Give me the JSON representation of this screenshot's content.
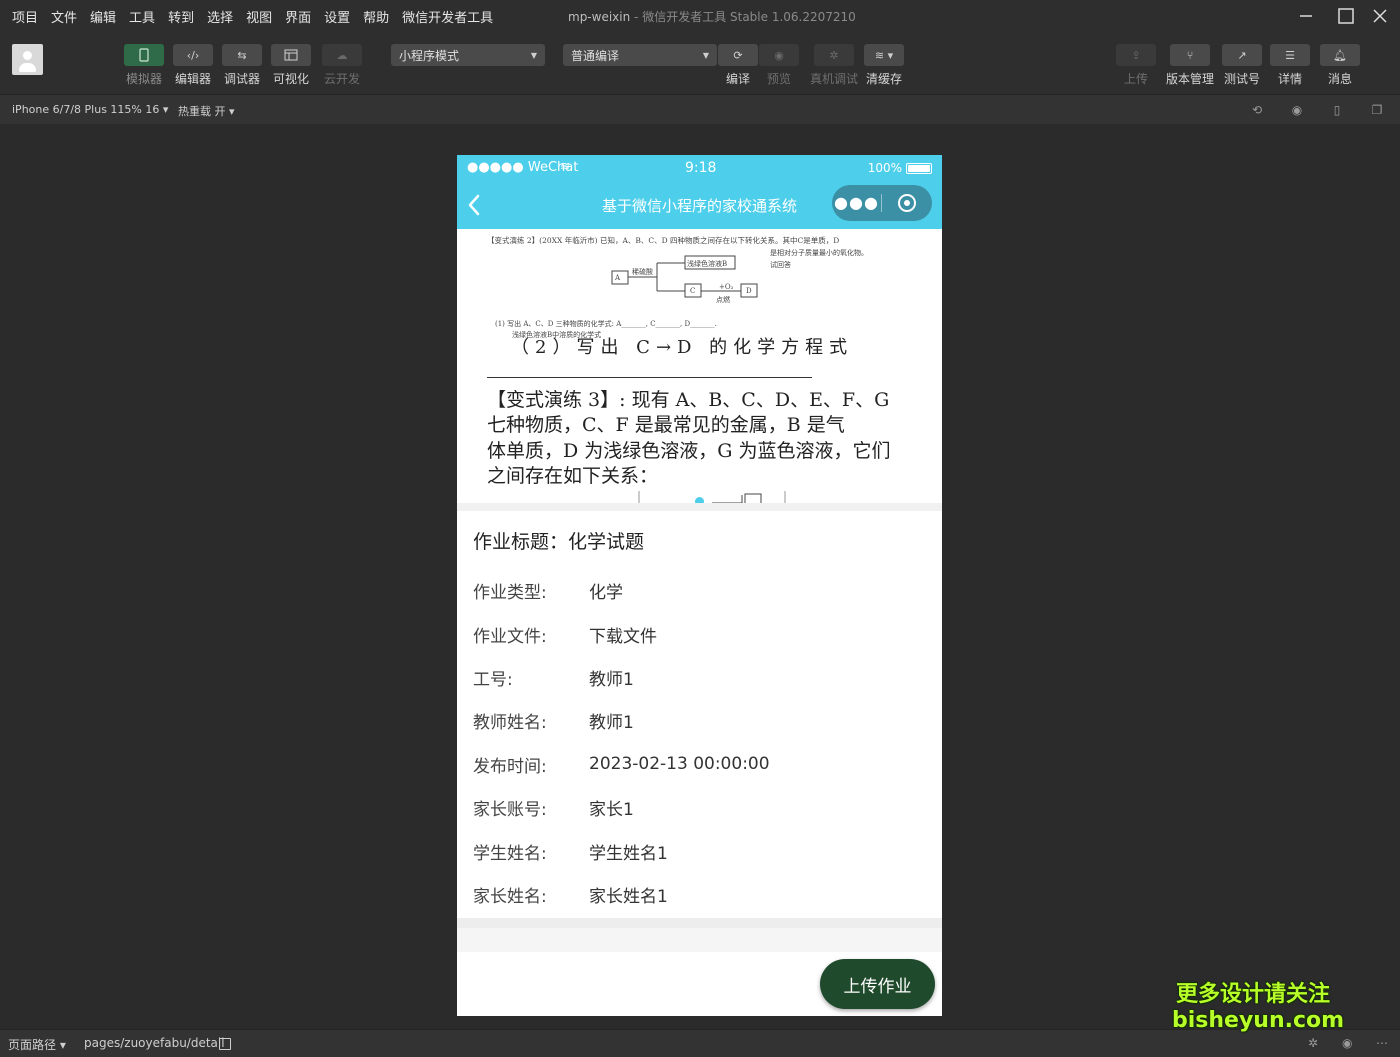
{
  "menu": [
    "项目",
    "文件",
    "编辑",
    "工具",
    "转到",
    "选择",
    "视图",
    "界面",
    "设置",
    "帮助",
    "微信开发者工具"
  ],
  "window_title": {
    "app": "mp-weixin",
    "sep": " - ",
    "ide": "微信开发者工具 Stable 1.06.2207210"
  },
  "toolbar": {
    "left_tools": [
      {
        "label": "模拟器",
        "icon": "phone-icon"
      },
      {
        "label": "编辑器",
        "icon": "code-icon"
      },
      {
        "label": "调试器",
        "icon": "debug-icon"
      },
      {
        "label": "可视化",
        "icon": "layout-icon"
      },
      {
        "label": "云开发",
        "icon": "cloud-icon"
      }
    ],
    "mode_select": "小程序模式",
    "compile_select": "普通编译",
    "compile_tools": [
      {
        "label": "编译",
        "icon": "refresh-icon"
      },
      {
        "label": "预览",
        "icon": "eye-icon"
      },
      {
        "label": "真机调试",
        "icon": "bug-icon"
      },
      {
        "label": "清缓存",
        "icon": "layers-icon"
      }
    ],
    "right_tools": [
      {
        "label": "上传",
        "icon": "upload-icon"
      },
      {
        "label": "版本管理",
        "icon": "branch-icon"
      },
      {
        "label": "测试号",
        "icon": "external-link-icon"
      },
      {
        "label": "详情",
        "icon": "menu-icon"
      },
      {
        "label": "消息",
        "icon": "bell-icon"
      }
    ]
  },
  "devicebar": {
    "device": "iPhone 6/7/8 Plus 115% 16 ▾",
    "hotreload": "热重载 开 ▾"
  },
  "phone": {
    "status": {
      "signal": "●●●●● WeChat",
      "time": "9:18",
      "battery": "100%"
    },
    "nav_title": "基于微信小程序的家校通系统",
    "swiper_doc": {
      "line1": "【变式演练 2】(20XX 年临沂市) 已知，A、B、C、D 四种物质之间存在以下转化关系。其中C是单质，D",
      "line2": "是相对分子质量最小的氧化物。",
      "line3": "试回答",
      "box_a": "A",
      "box_b": "浅绿色溶液B",
      "box_c": "C",
      "box_d": "D",
      "arrow1": "稀硫酸",
      "arrow2": "+O₂",
      "arrow3": "点燃",
      "q1": "(1) 写出 A、C、D 三种物质的化学式: A_______, C_______, D_______.",
      "q1b": "浅绿色溶液B中溶质的化学式",
      "q2": "（2）写出 C→D 的化学方程式",
      "p1": "【变式演练 3】: 现有 A、B、C、D、E、F、G",
      "p2": "七种物质，C、F 是最常见的金属，B 是气",
      "p3": "体单质，D 为浅绿色溶液，G 为蓝色溶液，它们",
      "p4": "之间存在如下关系："
    },
    "detail_title": "作业标题：化学试题",
    "fields": [
      {
        "k": "作业类型:",
        "v": "化学"
      },
      {
        "k": "作业文件:",
        "v": "下载文件"
      },
      {
        "k": "工号:",
        "v": "教师1"
      },
      {
        "k": "教师姓名:",
        "v": "教师1"
      },
      {
        "k": "发布时间:",
        "v": "2023-02-13 00:00:00"
      },
      {
        "k": "家长账号:",
        "v": "家长1"
      },
      {
        "k": "学生姓名:",
        "v": "学生姓名1"
      },
      {
        "k": "家长姓名:",
        "v": "家长姓名1"
      }
    ],
    "upload_button": "上传作业"
  },
  "bottombar": {
    "page_path_label": "页面路径 ▾",
    "page_path": "pages/zuoyefabu/detail"
  },
  "watermark": {
    "line1": "更多设计请关注",
    "line2": "bisheyun.com"
  },
  "colors": {
    "nav": "#4dcfeb",
    "upload_button": "#1f4a2c",
    "active_tool": "#2f6b48"
  }
}
